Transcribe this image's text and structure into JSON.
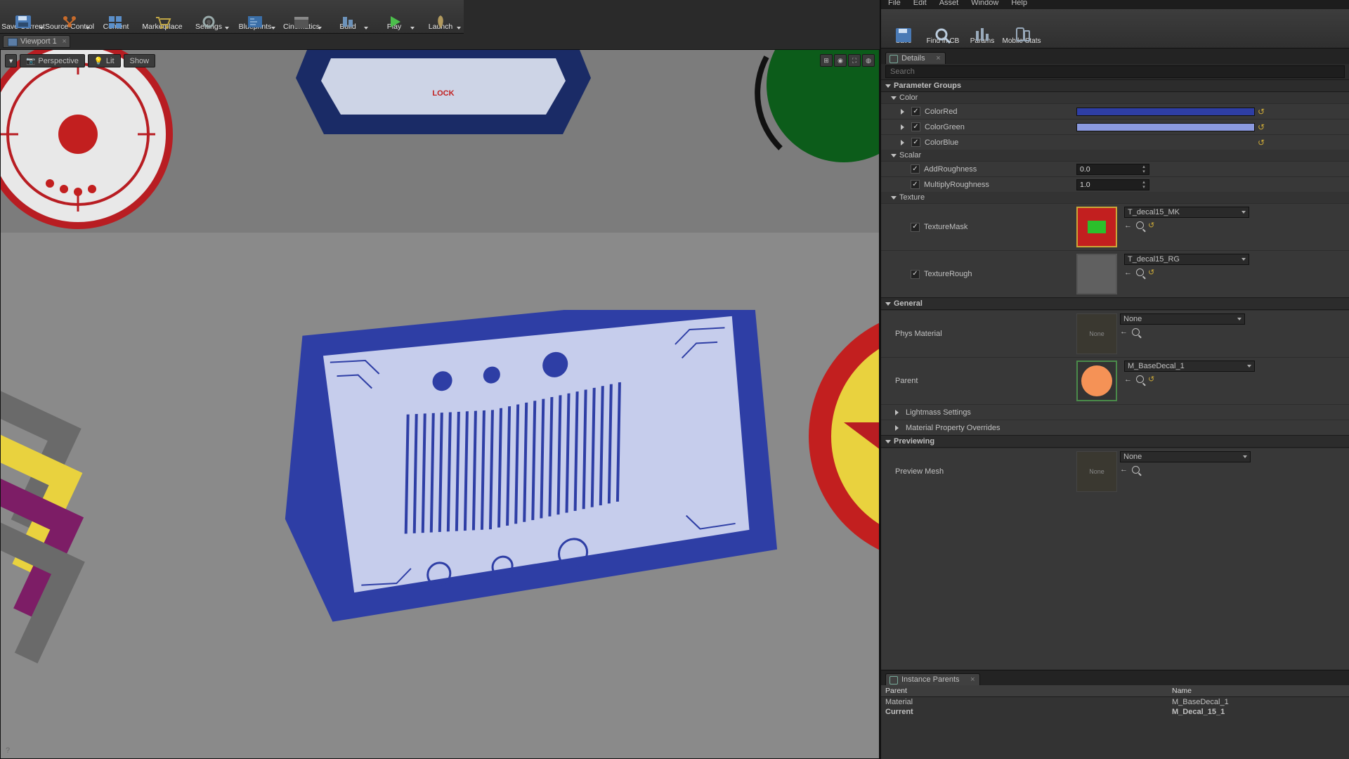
{
  "toolbar": {
    "items": [
      "Save Current",
      "Source Control",
      "Content",
      "Marketplace",
      "Settings",
      "Blueprints",
      "Cinematics",
      "Build",
      "Play",
      "Launch"
    ]
  },
  "viewport_tab": "Viewport 1",
  "viewport": {
    "perspective": "Perspective",
    "lit": "Lit",
    "show": "Show"
  },
  "right_menu": [
    "File",
    "Edit",
    "Asset",
    "Window",
    "Help"
  ],
  "right_toolbar": [
    "Save",
    "Find in CB",
    "Params",
    "Mobile Stats"
  ],
  "details_tab": "Details",
  "search_placeholder": "Search",
  "sections": {
    "param_groups": "Parameter Groups",
    "color": "Color",
    "scalar": "Scalar",
    "texture": "Texture",
    "general": "General",
    "lightmass": "Lightmass Settings",
    "mat_over": "Material Property Overrides",
    "previewing": "Previewing"
  },
  "params": {
    "color_red": {
      "label": "ColorRed",
      "checked": true,
      "color": "#2e3ea5"
    },
    "color_green": {
      "label": "ColorGreen",
      "checked": true,
      "color": "#8b9ae0"
    },
    "color_blue": {
      "label": "ColorBlue",
      "checked": true,
      "color": ""
    },
    "add_rough": {
      "label": "AddRoughness",
      "checked": true,
      "value": "0.0"
    },
    "mult_rough": {
      "label": "MultiplyRoughness",
      "checked": true,
      "value": "1.0"
    },
    "tex_mask": {
      "label": "TextureMask",
      "checked": true,
      "asset": "T_decal15_MK"
    },
    "tex_rough": {
      "label": "TextureRough",
      "checked": true,
      "asset": "T_decal15_RG"
    }
  },
  "general": {
    "phys": {
      "label": "Phys Material",
      "value": "None"
    },
    "parent": {
      "label": "Parent",
      "value": "M_BaseDecal_1"
    }
  },
  "preview": {
    "label": "Preview Mesh",
    "value": "None"
  },
  "ip_tab": "Instance Parents",
  "ip_headers": {
    "c1": "Parent",
    "c2": "Name"
  },
  "ip_rows": [
    {
      "c1": "Material",
      "c2": "M_BaseDecal_1"
    },
    {
      "c1": "Current",
      "c2": "M_Decal_15_1"
    }
  ],
  "decal_text": "LOCK",
  "none_label": "None"
}
